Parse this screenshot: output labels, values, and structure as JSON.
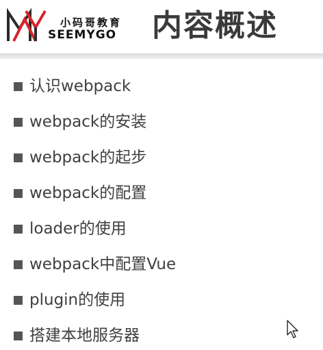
{
  "header": {
    "logo": {
      "brand_cn": "小码哥教育",
      "brand_en": "SEEMYGO"
    },
    "title": "内容概述"
  },
  "bullets": [
    "认识webpack",
    "webpack的安装",
    "webpack的起步",
    "webpack的配置",
    "loader的使用",
    "webpack中配置Vue",
    "plugin的使用",
    "搭建本地服务器"
  ],
  "colors": {
    "logo_red": "#d8232a",
    "logo_dark": "#2a2a2a",
    "title": "#3a3a3a",
    "bullet": "#555555",
    "text": "#3f3f3f"
  },
  "icons": {
    "cursor": "mouse-pointer-icon"
  }
}
